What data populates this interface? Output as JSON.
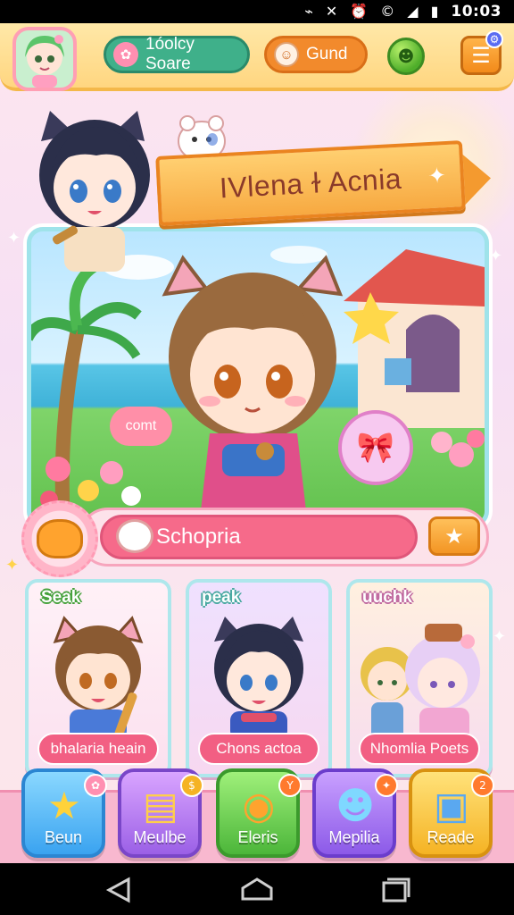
{
  "status_bar": {
    "time": "10:03",
    "icons": [
      "signal-muted-icon",
      "mute-icon",
      "alarm-icon",
      "copyright-icon",
      "cell-signal-icon",
      "battery-icon"
    ],
    "icon_glyphs": [
      "⌁",
      "✕",
      "⏰",
      "©",
      "◢",
      "▮"
    ]
  },
  "top_bar": {
    "score_label": "1óolcy Soare",
    "guild_label": "Gund",
    "score_icon": "✿",
    "guild_icon": "☺",
    "orb_glyph": "☻",
    "menu_glyph": "☰",
    "notif_glyph": "⚙"
  },
  "banner": {
    "title": "IVlena ɫ Acnia",
    "sparkle": "✦"
  },
  "scene": {
    "bubble_text": "comt",
    "gift_glyph": "🎀"
  },
  "name_bar": {
    "name": "Schopria",
    "fav_glyph": "★"
  },
  "cards": [
    {
      "tag": "Seak",
      "label": "bhalaria heain"
    },
    {
      "tag": "peak",
      "label": "Chons actoa"
    },
    {
      "tag": "uuchk",
      "label": "Nhomlia Poets"
    }
  ],
  "nav": [
    {
      "label": "Beun",
      "icon": "★",
      "badge": "✿"
    },
    {
      "label": "Meulbe",
      "icon": "▤",
      "badge": "$"
    },
    {
      "label": "Eleris",
      "icon": "◉",
      "badge": "Y"
    },
    {
      "label": "Mepilia",
      "icon": "☻",
      "badge": "✦"
    },
    {
      "label": "Reade",
      "icon": "▣",
      "badge": "2"
    }
  ],
  "colors": {
    "accent": "#f66a8a",
    "banner": "#f7a941",
    "card_border": "#aee7ec"
  }
}
